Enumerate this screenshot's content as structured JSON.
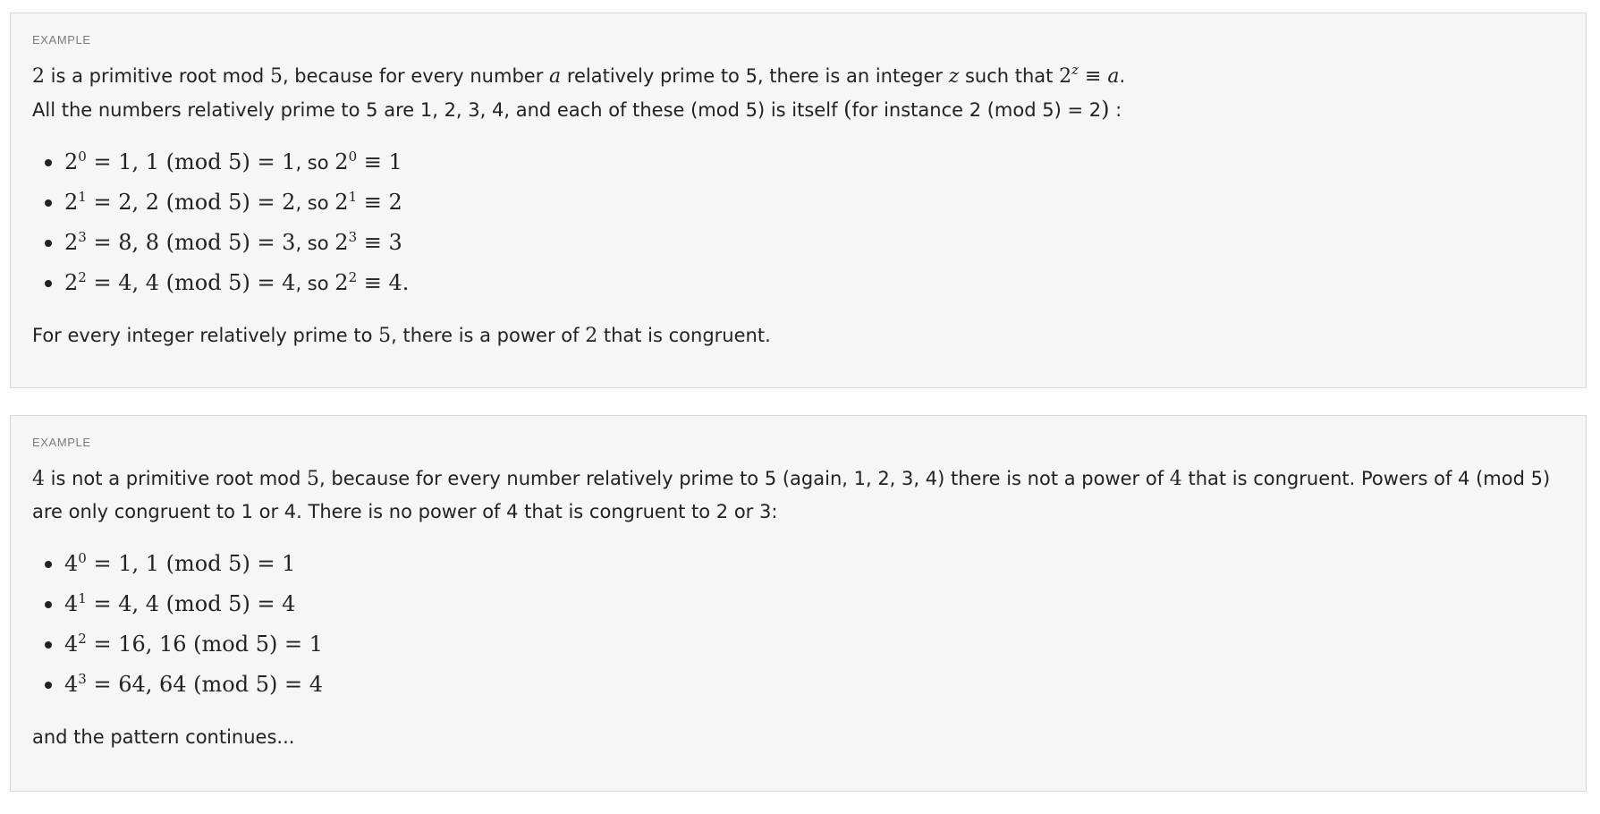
{
  "example1": {
    "label": "EXAMPLE",
    "intro": {
      "n2": "2",
      "t1": " is a primitive root mod ",
      "n5": "5",
      "t2": ", because for every number ",
      "var_a": "a",
      "t3": " relatively prime to 5, there is an integer ",
      "var_z": "z",
      "t4": " such that ",
      "base": "2",
      "exp": "z",
      "t5": " ≡ ",
      "var_a2": "a",
      "t6": "."
    },
    "second_line": {
      "t1": "All the numbers relatively prime to 5 are 1, 2, 3, 4, and each of these (mod 5) is itself ",
      "paren_open": "(",
      "t2": "for instance 2 (mod 5) = 2",
      "paren_close": ")",
      "t3": " :"
    },
    "items": [
      {
        "base": "2",
        "exp": "0",
        "eq1": " = 1,  1 (mod 5) = 1",
        "so": ", so ",
        "base2": "2",
        "exp2": "0",
        "eq2": " ≡ 1"
      },
      {
        "base": "2",
        "exp": "1",
        "eq1": " = 2,  2 (mod 5) = 2",
        "so": ", so ",
        "base2": "2",
        "exp2": "1",
        "eq2": " ≡ 2"
      },
      {
        "base": "2",
        "exp": "3",
        "eq1": " = 8,  8 (mod 5) = 3",
        "so": ", so ",
        "base2": "2",
        "exp2": "3",
        "eq2": " ≡ 3"
      },
      {
        "base": "2",
        "exp": "2",
        "eq1": " = 4,  4 (mod 5) = 4",
        "so": ", so ",
        "base2": "2",
        "exp2": "2",
        "eq2": " ≡ 4."
      }
    ],
    "closing": {
      "t1": "For every integer relatively prime to ",
      "n5": "5",
      "t2": ", there is a power of ",
      "n2": "2",
      "t3": " that is congruent."
    }
  },
  "example2": {
    "label": "EXAMPLE",
    "intro": {
      "n4": "4",
      "t1": " is not a primitive root mod ",
      "n5": "5",
      "t2": ", because for every number relatively prime to 5 (again, 1, 2, 3, 4) there is not a power of ",
      "n4b": "4",
      "t3": " that is congruent. Powers of 4 (mod 5) are only congruent to 1 or 4. There is no power of 4 that is congruent to 2 or 3:"
    },
    "items": [
      {
        "base": "4",
        "exp": "0",
        "eq": " = 1,  1 (mod 5) = 1"
      },
      {
        "base": "4",
        "exp": "1",
        "eq": " = 4,  4 (mod 5) = 4"
      },
      {
        "base": "4",
        "exp": "2",
        "eq": " = 16,  16 (mod 5) = 1"
      },
      {
        "base": "4",
        "exp": "3",
        "eq": " = 64,  64 (mod 5) = 4"
      }
    ],
    "closing": "and the pattern continues..."
  }
}
